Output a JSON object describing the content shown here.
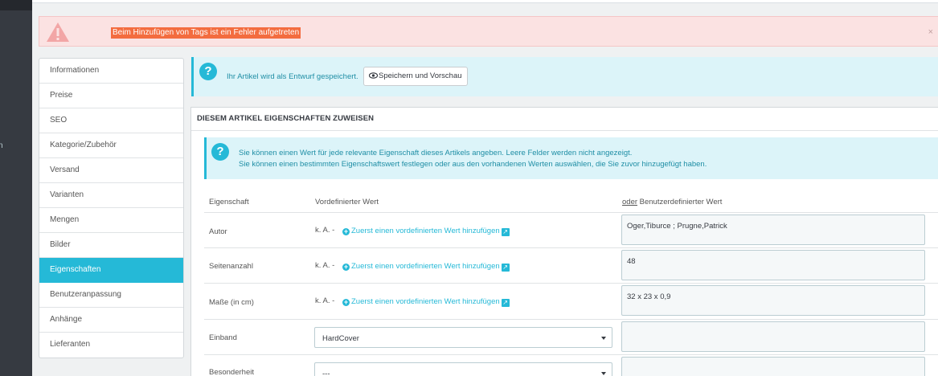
{
  "sidebar": {
    "fragment": "n"
  },
  "alert": {
    "message": "Beim Hinzufügen von Tags ist ein Fehler aufgetreten",
    "close": "×",
    "color": "#f36c3f"
  },
  "tabs": [
    {
      "label": "Informationen"
    },
    {
      "label": "Preise"
    },
    {
      "label": "SEO"
    },
    {
      "label": "Kategorie/Zubehör"
    },
    {
      "label": "Versand"
    },
    {
      "label": "Varianten"
    },
    {
      "label": "Mengen"
    },
    {
      "label": "Bilder"
    },
    {
      "label": "Eigenschaften",
      "active": true
    },
    {
      "label": "Benutzeranpassung"
    },
    {
      "label": "Anhänge"
    },
    {
      "label": "Lieferanten"
    }
  ],
  "draft": {
    "text": "Ihr Artikel wird als Entwurf gespeichert.",
    "button": "Speichern und Vorschau",
    "icon": "eye-icon"
  },
  "panel": {
    "heading": "DIESEM ARTIKEL EIGENSCHAFTEN ZUWEISEN",
    "info_line1": "Sie können einen Wert für jede relevante Eigenschaft dieses Artikels angeben. Leere Felder werden nicht angezeigt.",
    "info_line2": "Sie können einen bestimmten Eigenschaftswert festlegen oder aus den vorhandenen Werten auswählen, die Sie zuvor hinzugefügt haben."
  },
  "table": {
    "col_feature": "Eigenschaft",
    "col_predefined": "Vordefinierter Wert",
    "col_custom_or": "oder",
    "col_custom": " Benutzerdefinierter Wert",
    "rows": [
      {
        "label": "Autor",
        "ka": "k. A. -",
        "link": "Zuerst einen vordefinierten Wert hinzufügen",
        "custom": "Oger,Tiburce ; Prugne,Patrick"
      },
      {
        "label": "Seitenanzahl",
        "ka": "k. A. -",
        "link": "Zuerst einen vordefinierten Wert hinzufügen",
        "custom": "48"
      },
      {
        "label": "Maße (in cm)",
        "ka": "k. A. -",
        "link": "Zuerst einen vordefinierten Wert hinzufügen",
        "custom": "32 x 23 x 0,9"
      },
      {
        "label": "Einband",
        "select": "HardCover",
        "custom": ""
      },
      {
        "label": "Besonderheit",
        "select": "---",
        "custom": ""
      }
    ]
  },
  "colors": {
    "accent": "#25b9d7",
    "sidebar": "#363a41",
    "error_bg": "#fbe2e2",
    "info_bg": "#dcf4f9"
  }
}
